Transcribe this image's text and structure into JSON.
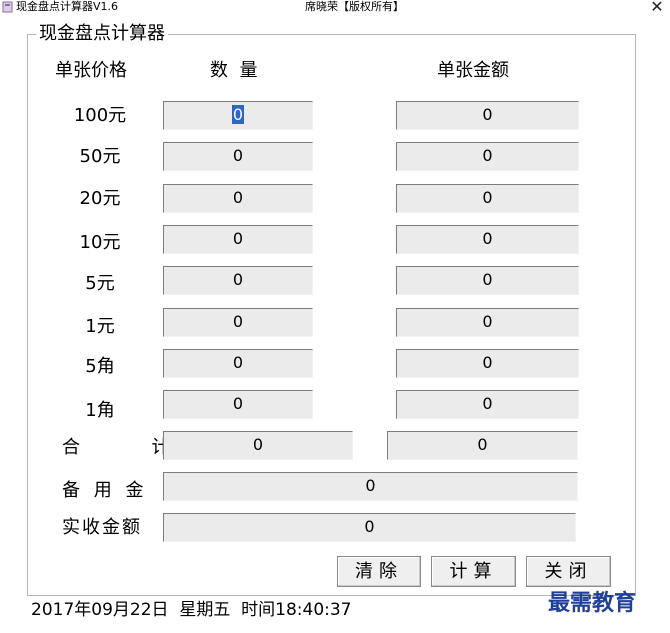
{
  "window": {
    "title": "现金盘点计算器V1.6",
    "center_text": "席晓荣【版权所有】",
    "close_glyph": "✕"
  },
  "group": {
    "title": "现金盘点计算器",
    "headers": {
      "price": "单张价格",
      "quantity": "数  量",
      "amount": "单张金额"
    }
  },
  "rows": [
    {
      "label": "100元",
      "quantity": "0",
      "amount": "0"
    },
    {
      "label": "50元",
      "quantity": "0",
      "amount": "0"
    },
    {
      "label": "20元",
      "quantity": "0",
      "amount": "0"
    },
    {
      "label": "10元",
      "quantity": "0",
      "amount": "0"
    },
    {
      "label": "5元",
      "quantity": "0",
      "amount": "0"
    },
    {
      "label": "1元",
      "quantity": "0",
      "amount": "0"
    },
    {
      "label": "5角",
      "quantity": "0",
      "amount": "0"
    },
    {
      "label": "1角",
      "quantity": "0",
      "amount": "0"
    }
  ],
  "total": {
    "label": "合  计",
    "quantity": "0",
    "amount": "0"
  },
  "reserve": {
    "label": "备 用 金",
    "value": "0"
  },
  "actual": {
    "label": "实收金额",
    "value": "0"
  },
  "buttons": {
    "clear": "清除",
    "calculate": "计算",
    "close": "关闭"
  },
  "status": {
    "datetime": "2017年09月22日  星期五  时间18:40:37"
  },
  "watermark": {
    "text": "最需教育"
  },
  "colors": {
    "selection": "#2a67c6",
    "field_bg": "#ebebeb",
    "watermark": "#1f3f99"
  }
}
